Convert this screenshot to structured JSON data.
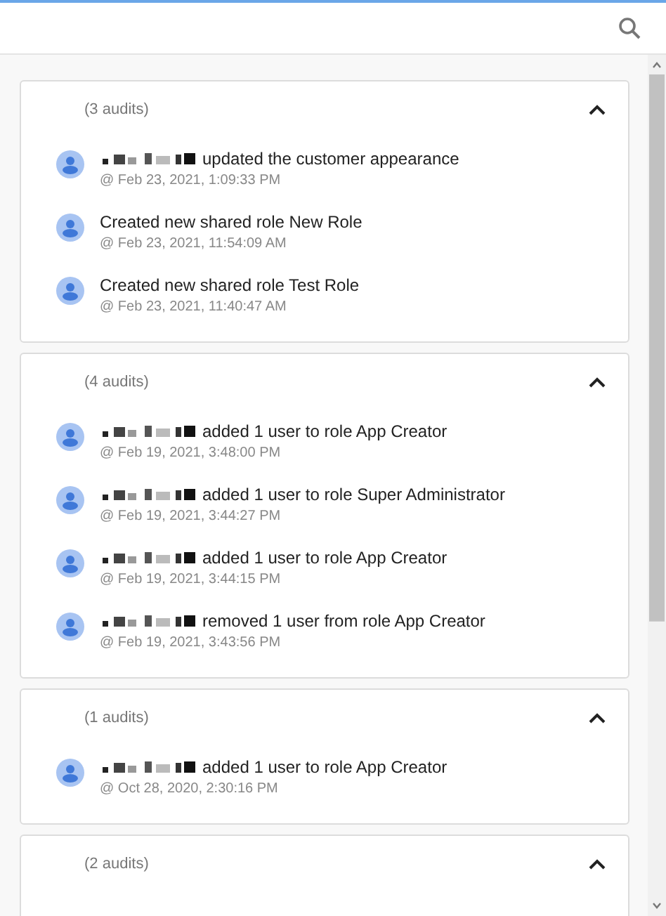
{
  "groups": [
    {
      "count": "(3 audits)",
      "expanded": true,
      "items": [
        {
          "name_hidden": true,
          "text": "updated the customer appearance",
          "time": "@ Feb 23, 2021, 1:09:33 PM"
        },
        {
          "name_hidden": false,
          "text": "Created new shared role New Role",
          "time": "@ Feb 23, 2021, 11:54:09 AM"
        },
        {
          "name_hidden": false,
          "text": "Created new shared role Test Role",
          "time": "@ Feb 23, 2021, 11:40:47 AM"
        }
      ]
    },
    {
      "count": "(4 audits)",
      "expanded": true,
      "items": [
        {
          "name_hidden": true,
          "text": "added 1 user to role App Creator",
          "time": "@ Feb 19, 2021, 3:48:00 PM"
        },
        {
          "name_hidden": true,
          "text": "added 1 user to role Super Administrator",
          "time": "@ Feb 19, 2021, 3:44:27 PM"
        },
        {
          "name_hidden": true,
          "text": "added 1 user to role App Creator",
          "time": "@ Feb 19, 2021, 3:44:15 PM"
        },
        {
          "name_hidden": true,
          "text": "removed 1 user from role App Creator",
          "time": "@ Feb 19, 2021, 3:43:56 PM"
        }
      ]
    },
    {
      "count": "(1 audits)",
      "expanded": true,
      "items": [
        {
          "name_hidden": true,
          "text": "added 1 user to role App Creator",
          "time": "@ Oct 28, 2020, 2:30:16 PM"
        }
      ]
    },
    {
      "count": "(2 audits)",
      "expanded": true
    }
  ]
}
